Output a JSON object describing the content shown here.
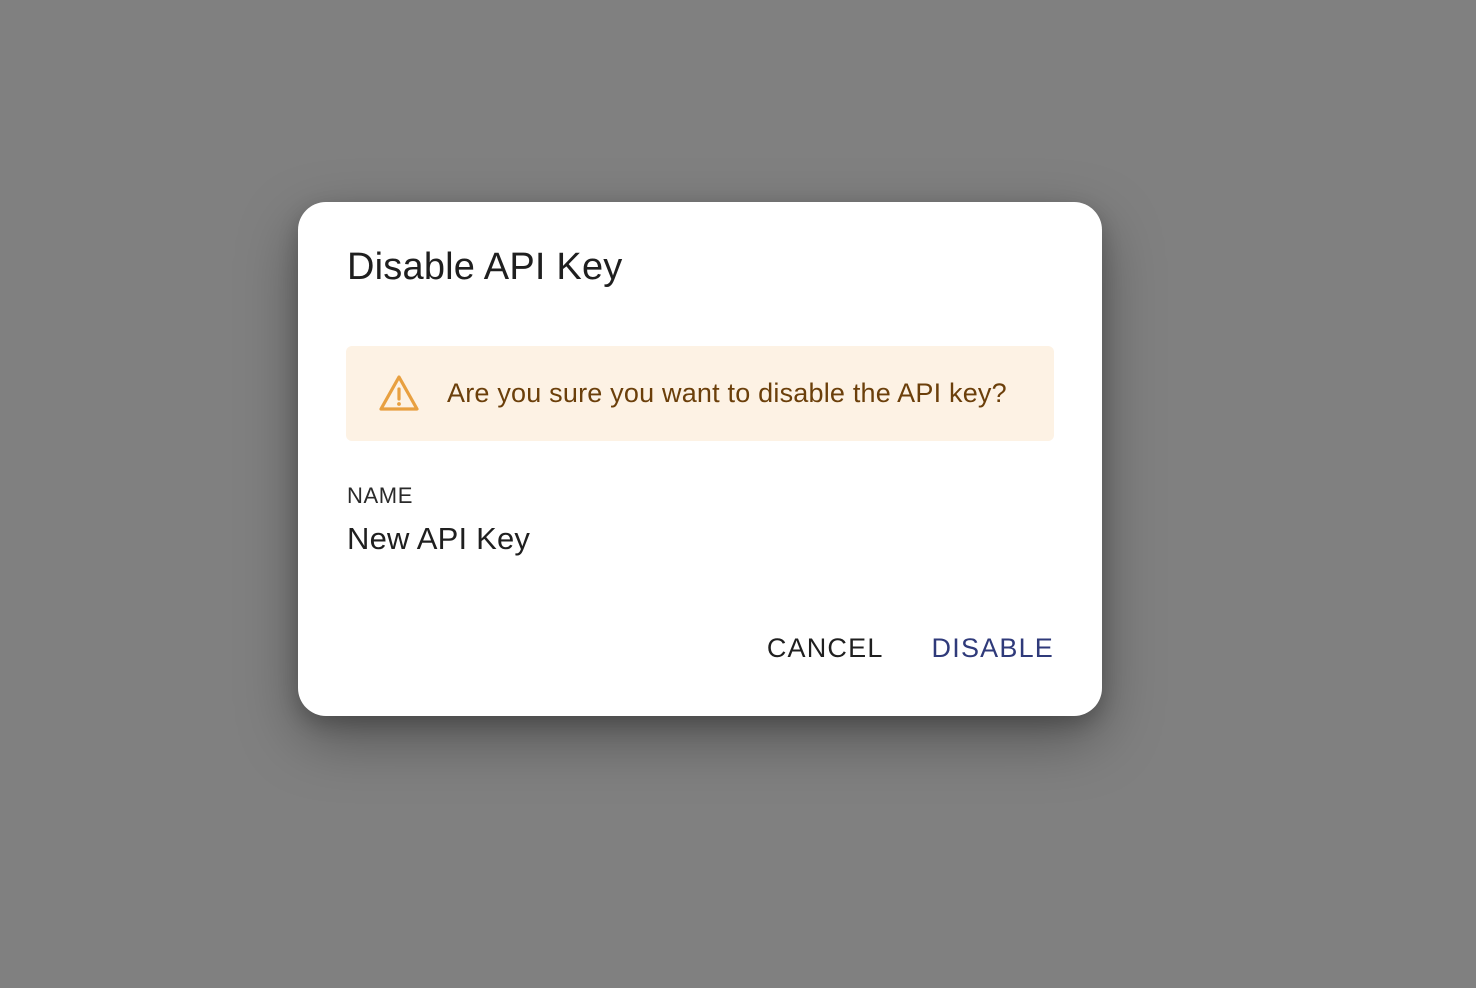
{
  "dialog": {
    "title": "Disable API Key",
    "alert": {
      "icon": "warning-triangle-icon",
      "message": "Are you sure you want to disable the API key?",
      "background_color": "#fdf2e4",
      "text_color": "#6b3f0a",
      "icon_color": "#e8a040"
    },
    "field": {
      "label": "NAME",
      "value": "New API Key"
    },
    "actions": {
      "cancel_label": "CANCEL",
      "disable_label": "DISABLE",
      "primary_color": "#2f3a7a"
    }
  },
  "backdrop_color": "#808080"
}
